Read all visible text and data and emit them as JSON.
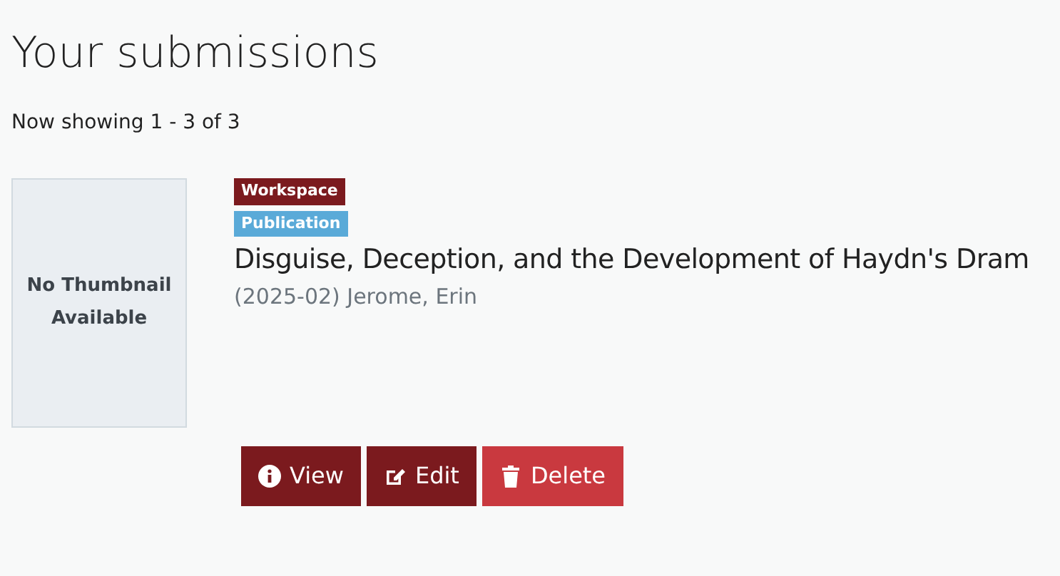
{
  "heading": "Your submissions",
  "pagination": "Now showing 1 - 3 of 3",
  "submissions": [
    {
      "thumbnail": "No Thumbnail Available",
      "badges": [
        {
          "label": "Workspace",
          "color": "#7b1a1e"
        },
        {
          "label": "Publication",
          "color": "#5aaad8"
        }
      ],
      "title": "Disguise, Deception, and the Development of Haydn's Dram",
      "meta": "(2025-02) Jerome, Erin",
      "actions": [
        {
          "kind": "view",
          "label": "View"
        },
        {
          "kind": "edit",
          "label": "Edit"
        },
        {
          "kind": "delete",
          "label": "Delete"
        }
      ]
    }
  ]
}
